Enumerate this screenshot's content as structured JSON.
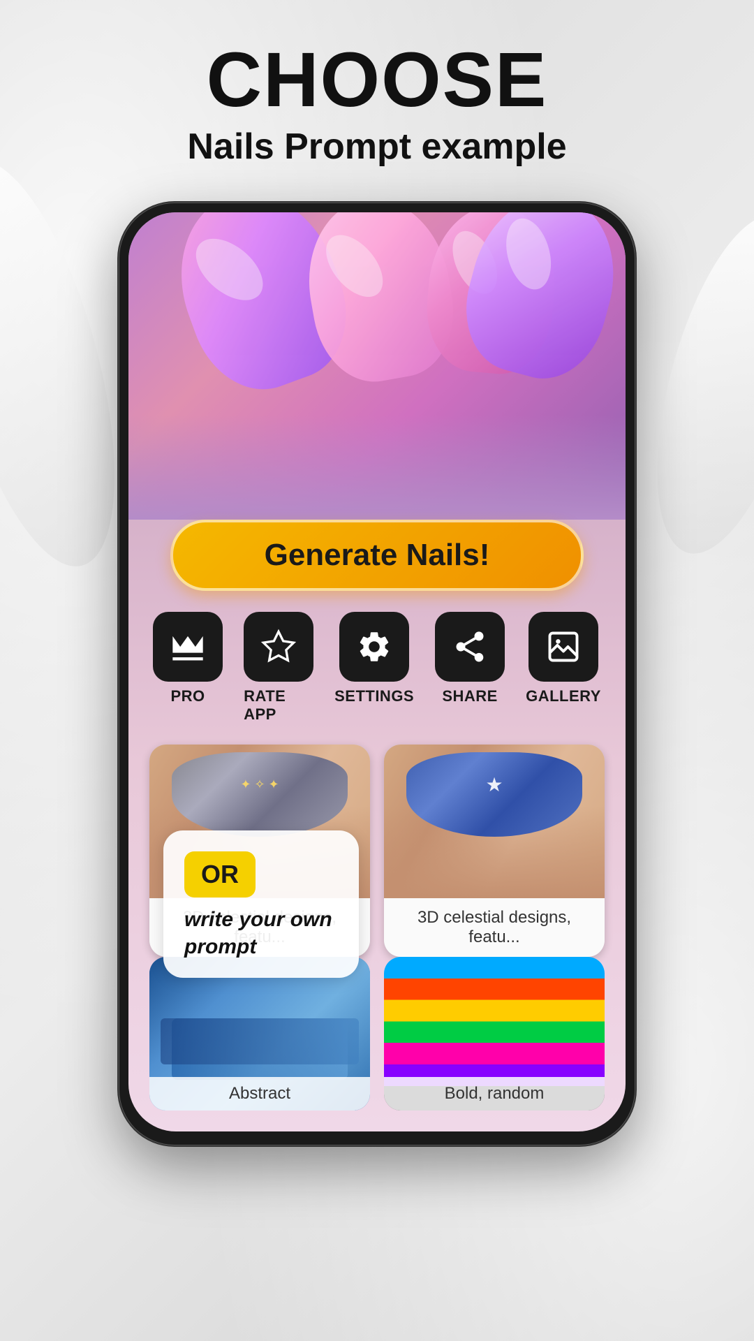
{
  "header": {
    "title": "CHOOSE",
    "subtitle": "Nails Prompt example"
  },
  "phone": {
    "generate_button": "Generate Nails!",
    "actions": [
      {
        "id": "pro",
        "label": "PRO",
        "icon": "crown"
      },
      {
        "id": "rate_app",
        "label": "RATE APP",
        "icon": "star"
      },
      {
        "id": "settings",
        "label": "SETTINGS",
        "icon": "gear"
      },
      {
        "id": "share",
        "label": "SHARE",
        "icon": "share"
      },
      {
        "id": "gallery",
        "label": "GALLERY",
        "icon": "image"
      }
    ],
    "gallery_items": [
      {
        "id": "item1",
        "caption": "3D celestial designs, featu...",
        "style": "glitter"
      },
      {
        "id": "item2",
        "caption": "3D celestial designs, featu...",
        "style": "blue_glitter"
      },
      {
        "id": "item3",
        "caption": "Abstract",
        "style": "blue_matte"
      },
      {
        "id": "item4",
        "caption": "Bold, random",
        "style": "colorful"
      }
    ]
  },
  "overlay": {
    "or_label": "OR",
    "prompt_text": "write your own prompt"
  }
}
